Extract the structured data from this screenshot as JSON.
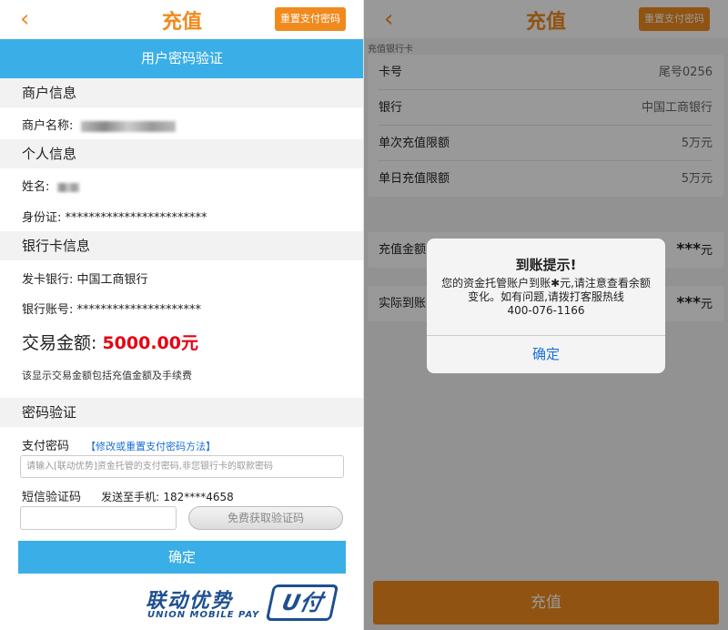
{
  "left": {
    "header": {
      "back_icon": "‹",
      "title": "充值",
      "reset_button": "重置支付密码"
    },
    "banner": "用户密码验证",
    "merchant": {
      "section": "商户信息",
      "name_label": "商户名称:"
    },
    "personal": {
      "section": "个人信息",
      "name_label": "姓名:",
      "id_label": "身份证:",
      "id_value": "************************"
    },
    "bank": {
      "section": "银行卡信息",
      "issuer_label": "发卡银行:",
      "issuer_value": "中国工商银行",
      "account_label": "银行账号:",
      "account_value": "*********************"
    },
    "amount": {
      "label": "交易金额:",
      "value": "5000.00元"
    },
    "note": "该显示交易金额包括充值金额及手续费",
    "password": {
      "section": "密码验证",
      "pay_pwd_label": "支付密码",
      "pay_pwd_link": "【修改或重置支付密码方法】",
      "pay_pwd_placeholder": "请输入[联动优势]资金托管的支付密码,非您银行卡的取款密码",
      "sms_label": "短信验证码",
      "sms_sent_label": "发送至手机:",
      "sms_phone": "182****4658",
      "sms_button": "免费获取验证码"
    },
    "confirm": "确定",
    "brand": {
      "cn": "联动优势",
      "en": "UNION MOBILE PAY",
      "logo": "U付"
    }
  },
  "right": {
    "header": {
      "back_icon": "‹",
      "title": "充值",
      "reset_button": "重置支付密码"
    },
    "card_section": "充值银行卡",
    "rows": [
      {
        "label": "卡号",
        "value": "尾号0256"
      },
      {
        "label": "银行",
        "value": "中国工商银行"
      },
      {
        "label": "单次充值限额",
        "value": "5万元"
      },
      {
        "label": "单日充值限额",
        "value": "5万元"
      }
    ],
    "recharge_amount": {
      "label": "充值金额",
      "value": "***",
      "unit": "元"
    },
    "actual_amount": {
      "label": "实际到账",
      "value": "***",
      "unit": "元"
    },
    "bottom_button": "充值",
    "dialog": {
      "title": "到账提示!",
      "message": "您的资金托管账户到账✱元,请注意查看余额变化。如有问题,请拨打客服热线",
      "phone": "400-076-1166",
      "ok": "确定"
    }
  },
  "colors": {
    "accent": "#f08a1d",
    "blue": "#3aaee6",
    "amount_red": "#e60012",
    "link": "#1a6fd6"
  }
}
